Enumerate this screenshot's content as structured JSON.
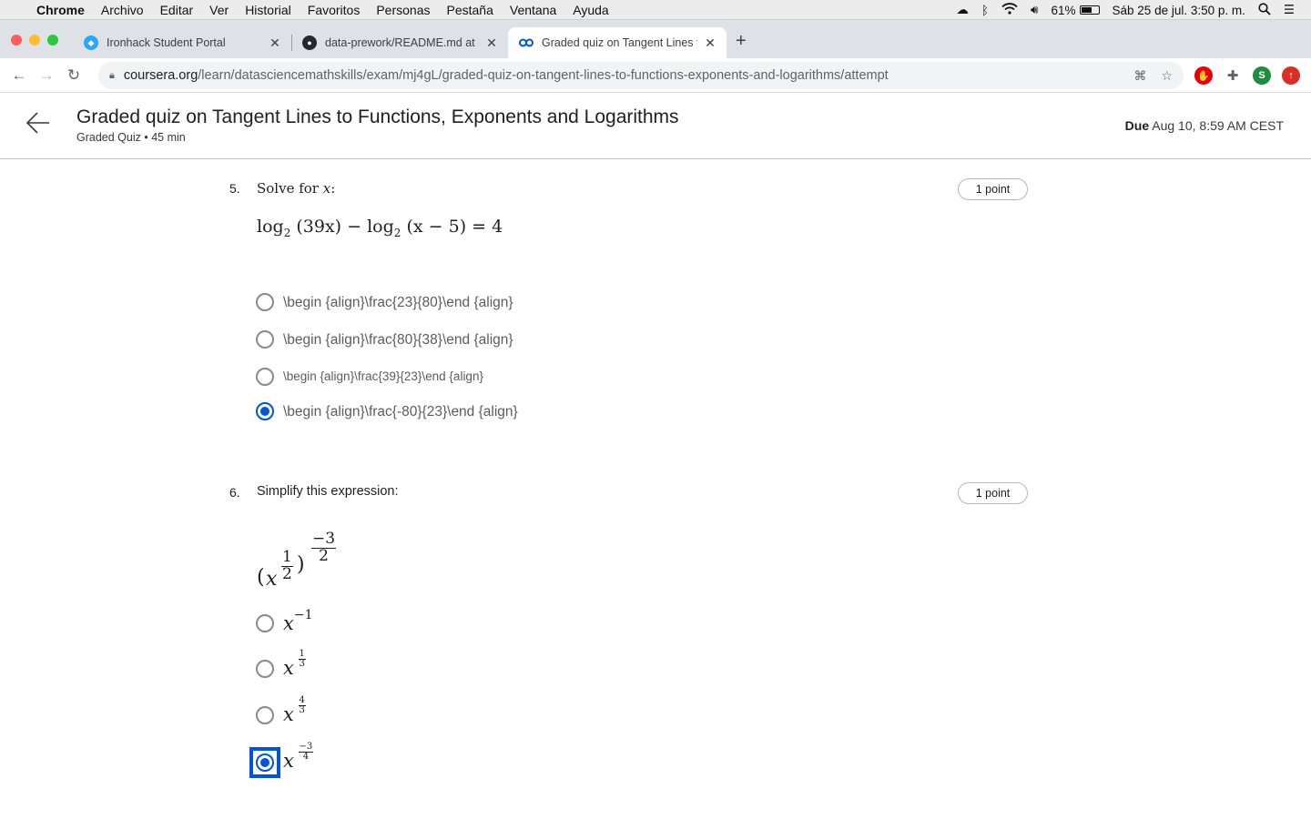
{
  "menubar": {
    "app": "Chrome",
    "items": [
      "Archivo",
      "Editar",
      "Ver",
      "Historial",
      "Favoritos",
      "Personas",
      "Pestaña",
      "Ventana",
      "Ayuda"
    ],
    "battery": "61%",
    "battery_level": 0.61,
    "datetime": "Sáb 25 de jul.  3:50 p. m."
  },
  "tabs": [
    {
      "title": "Ironhack Student Portal",
      "icon": "ironhack-icon"
    },
    {
      "title": "data-prework/README.md at m",
      "icon": "github-icon"
    },
    {
      "title": "Graded quiz on Tangent Lines t",
      "icon": "coursera-icon"
    }
  ],
  "address": {
    "host": "coursera.org",
    "path": "/learn/datasciencemathskills/exam/mj4gL/graded-quiz-on-tangent-lines-to-functions-exponents-and-logarithms/attempt"
  },
  "profile_initial": "S",
  "header": {
    "title": "Graded quiz on Tangent Lines to Functions, Exponents and Logarithms",
    "subtitle": "Graded Quiz • 45 min",
    "due_label": "Due",
    "due_value": "Aug 10, 8:59 AM CEST"
  },
  "questions": [
    {
      "number": "5.",
      "prompt_prefix": "Solve for ",
      "prompt_var": "x",
      "prompt_suffix": ":",
      "points": "1 point",
      "formula": {
        "log1": "log",
        "base1": "2",
        "arg1": "(39x)",
        "minus": "−",
        "log2": "log",
        "base2": "2",
        "arg2": "(x − 5)",
        "rhs": "= 4"
      },
      "options": [
        {
          "label": "\\begin {align}\\frac{23}{80}\\end {align}",
          "checked": false
        },
        {
          "label": "\\begin {align}\\frac{80}{38}\\end {align}",
          "checked": false
        },
        {
          "label": "\\begin {align}\\frac{39}{23}\\end {align}",
          "checked": false
        },
        {
          "label": "\\begin {align}\\frac{-80}{23}\\end {align}",
          "checked": true
        }
      ]
    },
    {
      "number": "6.",
      "prompt": "Simplify this expression:",
      "points": "1 point",
      "expression": {
        "base": "x",
        "inner_num": "1",
        "inner_den": "2",
        "outer_num": "−3",
        "outer_den": "2"
      },
      "options": [
        {
          "base": "x",
          "exp": "−1",
          "checked": false
        },
        {
          "base": "x",
          "num": "1",
          "den": "3",
          "checked": false
        },
        {
          "base": "x",
          "num": "4",
          "den": "3",
          "checked": false
        },
        {
          "base": "x",
          "num": "−3",
          "den": "4",
          "checked": true
        }
      ]
    }
  ]
}
